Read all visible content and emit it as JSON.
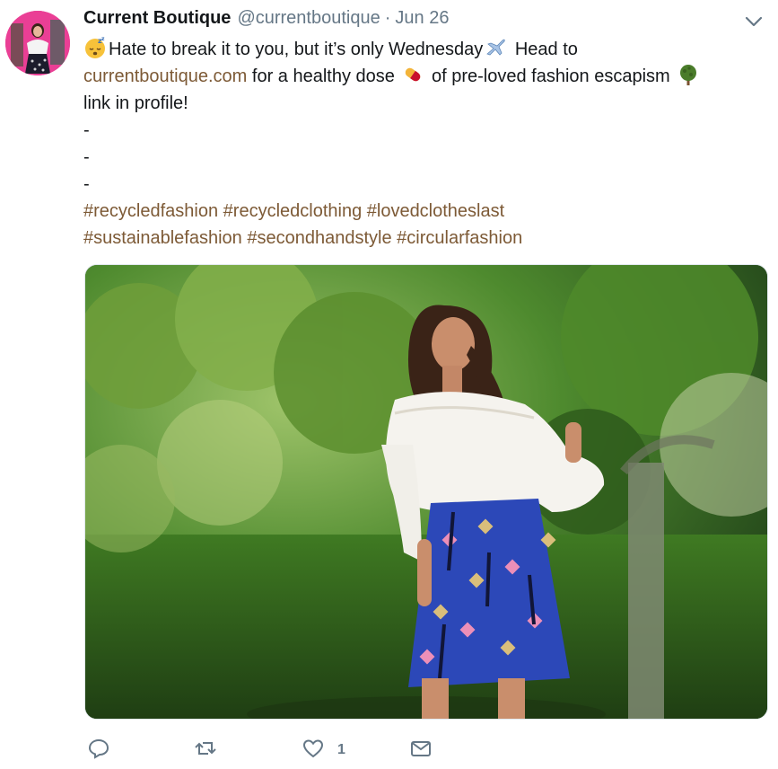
{
  "tweet": {
    "author_name": "Current Boutique",
    "author_handle": "@currentboutique",
    "separator": "·",
    "date": "Jun 26",
    "text": {
      "line1_a": "Hate to break it to you, but it’s only Wednesday",
      "line1_b": "Head to",
      "line2_link": "currentboutique.com",
      "line2_a": " for a healthy dose ",
      "line2_b": " of pre-loved fashion escapism ",
      "line3": "link in profile!",
      "dash1": "-",
      "dash2": "-",
      "dash3": "-"
    },
    "hashtags_line1": [
      "#recycledfashion",
      "#recycledclothing",
      "#lovedclotheslast"
    ],
    "hashtags_line2": [
      "#sustainablefashion",
      "#secondhandstyle",
      "#circularfashion"
    ],
    "actions": {
      "reply_count": "",
      "retweet_count": "",
      "like_count": "1",
      "dm_count": ""
    },
    "emojis": [
      "sleeping-face-icon",
      "airplane-icon",
      "pill-icon",
      "tree-icon"
    ],
    "colors": {
      "link": "#7d5a36",
      "text": "#14171a",
      "secondary": "#657786"
    }
  }
}
